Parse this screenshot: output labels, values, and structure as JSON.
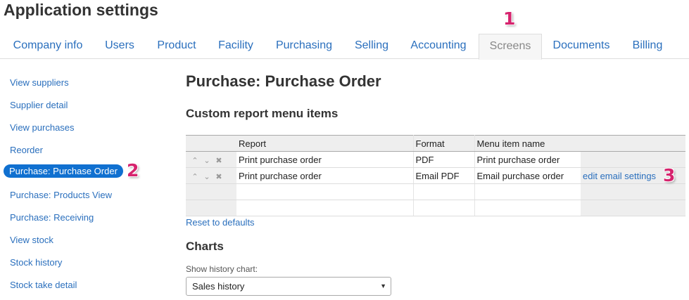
{
  "app": {
    "title": "Application settings"
  },
  "tabs": [
    {
      "label": "Company info"
    },
    {
      "label": "Users"
    },
    {
      "label": "Product"
    },
    {
      "label": "Facility"
    },
    {
      "label": "Purchasing"
    },
    {
      "label": "Selling"
    },
    {
      "label": "Accounting"
    },
    {
      "label": "Screens",
      "active": true
    },
    {
      "label": "Documents"
    },
    {
      "label": "Billing"
    }
  ],
  "markers": {
    "one": "1",
    "two": "2",
    "three": "3",
    "color": "#d6246e"
  },
  "sidebar": {
    "items": [
      {
        "label": "View suppliers"
      },
      {
        "label": "Supplier detail"
      },
      {
        "label": "View purchases"
      },
      {
        "label": "Reorder"
      },
      {
        "label": "Purchase: Purchase Order",
        "active": true
      },
      {
        "label": "Purchase: Products View"
      },
      {
        "label": "Purchase: Receiving"
      },
      {
        "label": "View stock"
      },
      {
        "label": "Stock history"
      },
      {
        "label": "Stock take detail"
      }
    ]
  },
  "main": {
    "title": "Purchase: Purchase Order",
    "custom_report_title": "Custom report menu items",
    "table": {
      "headers": {
        "report": "Report",
        "format": "Format",
        "menu_item_name": "Menu item name"
      },
      "row_controls": {
        "up_icon": "chevron-up-icon",
        "down_icon": "chevron-down-icon",
        "delete_icon": "close-icon"
      },
      "rows": [
        {
          "report": "Print purchase order",
          "format": "PDF",
          "menu_item_name": "Print purchase order",
          "action": ""
        },
        {
          "report": "Print purchase order",
          "format": "Email PDF",
          "menu_item_name": "Email purchase order",
          "action": "edit email settings"
        }
      ]
    },
    "reset_label": "Reset to defaults",
    "charts_title": "Charts",
    "history_chart": {
      "label": "Show history chart:",
      "value": "Sales history"
    }
  },
  "colors": {
    "link": "#2a6fbd",
    "active_sidebar": "#1070d0"
  }
}
